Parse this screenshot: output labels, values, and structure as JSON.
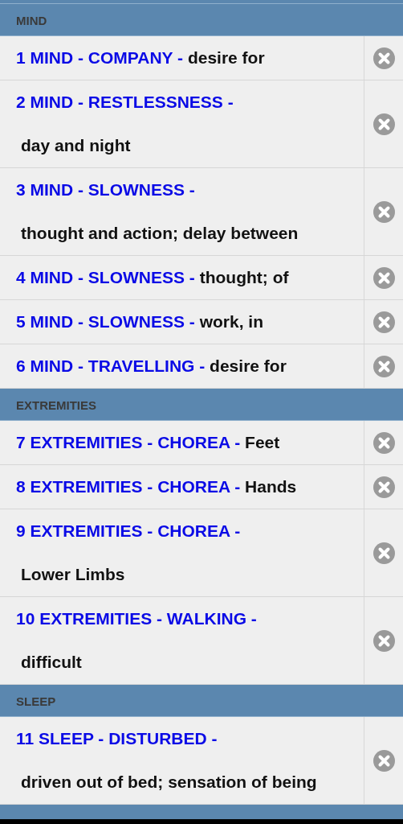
{
  "sections": [
    {
      "title": "MIND",
      "rows": [
        {
          "rubric": "1 MIND - COMPANY -",
          "detail": "desire for",
          "kind": "inline"
        },
        {
          "rubric": "2 MIND - RESTLESSNESS -",
          "detail": "day and night",
          "kind": "block"
        },
        {
          "rubric": "3 MIND - SLOWNESS -",
          "detail": "thought and action; delay between",
          "kind": "block"
        },
        {
          "rubric": "4 MIND - SLOWNESS -",
          "detail": "thought; of",
          "kind": "inline"
        },
        {
          "rubric": "5 MIND - SLOWNESS -",
          "detail": "work, in",
          "kind": "inline"
        },
        {
          "rubric": "6 MIND - TRAVELLING -",
          "detail": "desire for",
          "kind": "inline"
        }
      ]
    },
    {
      "title": "EXTREMITIES",
      "rows": [
        {
          "rubric": "7 EXTREMITIES - CHOREA -",
          "detail": "Feet",
          "kind": "inline"
        },
        {
          "rubric": "8 EXTREMITIES - CHOREA -",
          "detail": "Hands",
          "kind": "inline"
        },
        {
          "rubric": "9 EXTREMITIES - CHOREA -",
          "detail": "Lower Limbs",
          "kind": "block"
        },
        {
          "rubric": "10 EXTREMITIES - WALKING -",
          "detail": "difficult",
          "kind": "block"
        }
      ]
    },
    {
      "title": "SLEEP",
      "rows": [
        {
          "rubric": "11 SLEEP - DISTURBED -",
          "detail": "driven out of bed; sensation of being",
          "kind": "block"
        }
      ]
    },
    {
      "kind": "cut-off"
    }
  ]
}
